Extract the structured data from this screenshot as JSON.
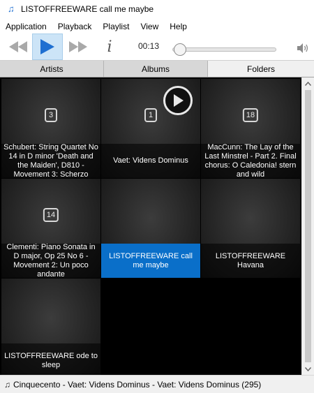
{
  "window": {
    "title": "LISTOFFREEWARE call me maybe",
    "icon": "music-note-icon"
  },
  "menu": [
    "Application",
    "Playback",
    "Playlist",
    "View",
    "Help"
  ],
  "toolbar": {
    "time": "00:13",
    "info_label": "i",
    "progress_fraction": 0.04,
    "accent": "#1f6fd1"
  },
  "tabs": [
    {
      "label": "Artists",
      "active": false
    },
    {
      "label": "Albums",
      "active": false
    },
    {
      "label": "Folders",
      "active": true
    }
  ],
  "tiles": [
    {
      "count": "3",
      "label": "Schubert: String Quartet No 14 in D minor 'Death and the Maiden', D810 - Movement 3: Scherzo"
    },
    {
      "count": "1",
      "label": "Vaet: Videns Dominus",
      "playing_overlay": true
    },
    {
      "count": "18",
      "label": "MacCunn: The Lay of the Last Minstrel - Part 2. Final chorus: O Caledonia! stern and wild"
    },
    {
      "count": "14",
      "label": "Clementi: Piano Sonata in D major, Op 25 No 6 - Movement 2: Un poco andante"
    },
    {
      "count": "",
      "label": "LISTOFFREEWARE call me maybe",
      "selected": true
    },
    {
      "count": "",
      "label": "LISTOFFREEWARE Havana"
    },
    {
      "count": "",
      "label": "LISTOFFREEWARE ode to sleep"
    }
  ],
  "status": {
    "text": "Cinquecento - Vaet: Videns Dominus - Vaet: Videns Dominus (295)"
  },
  "colors": {
    "selected": "#0a6fc9",
    "play_button_bg": "#cce4f7"
  }
}
